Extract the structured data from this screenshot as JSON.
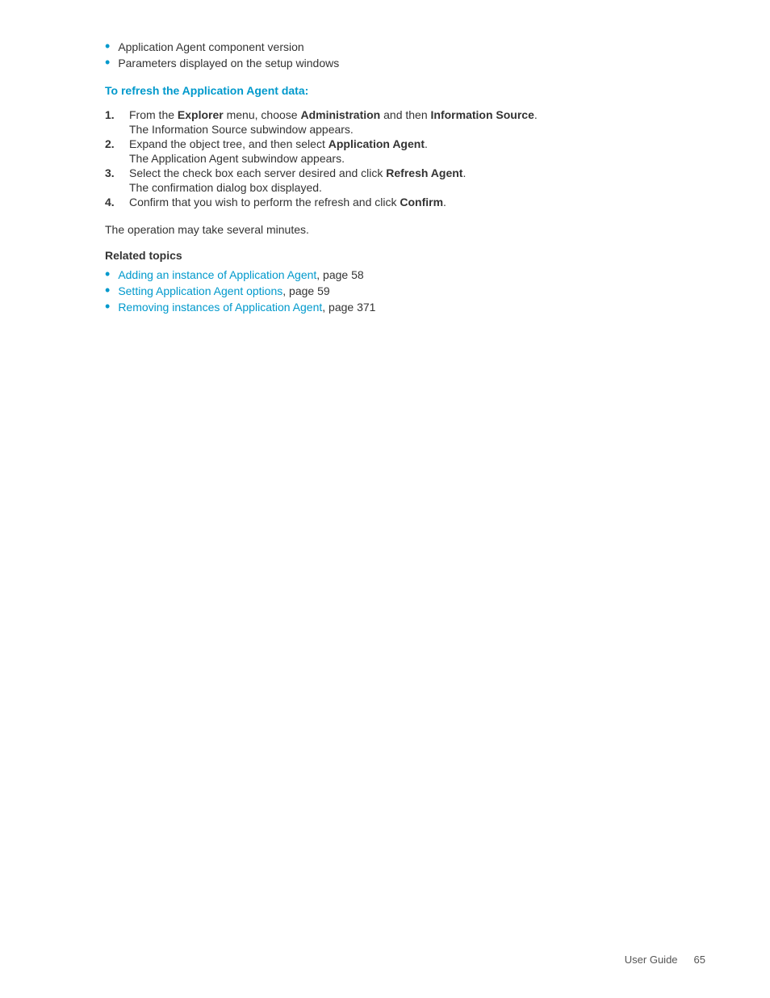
{
  "bullets": [
    "Application Agent component version",
    "Parameters displayed on the setup windows"
  ],
  "section_heading": "To refresh the Application Agent data:",
  "steps": [
    {
      "number": "1.",
      "text_parts": [
        {
          "text": "From the ",
          "bold": false
        },
        {
          "text": "Explorer",
          "bold": true
        },
        {
          "text": " menu, choose ",
          "bold": false
        },
        {
          "text": "Administration",
          "bold": true
        },
        {
          "text": " and then ",
          "bold": false
        },
        {
          "text": "Information Source",
          "bold": true
        },
        {
          "text": ".",
          "bold": false
        }
      ],
      "subtext": "The Information Source subwindow appears."
    },
    {
      "number": "2.",
      "text_parts": [
        {
          "text": "Expand the object tree, and then select ",
          "bold": false
        },
        {
          "text": "Application Agent",
          "bold": true
        },
        {
          "text": ".",
          "bold": false
        }
      ],
      "subtext": "The Application Agent subwindow appears."
    },
    {
      "number": "3.",
      "text_parts": [
        {
          "text": "Select the check box each server desired and click ",
          "bold": false
        },
        {
          "text": "Refresh Agent",
          "bold": true
        },
        {
          "text": ".",
          "bold": false
        }
      ],
      "subtext": "The confirmation dialog box displayed."
    },
    {
      "number": "4.",
      "text_parts": [
        {
          "text": "Confirm that you wish to perform the refresh and click ",
          "bold": false
        },
        {
          "text": "Confirm",
          "bold": true
        },
        {
          "text": ".",
          "bold": false
        }
      ],
      "subtext": ""
    }
  ],
  "operation_note": "The operation may take several minutes.",
  "related_topics_heading": "Related topics",
  "related_links": [
    {
      "link_text": "Adding an instance of Application Agent",
      "suffix": ", page 58"
    },
    {
      "link_text": "Setting Application Agent options",
      "suffix": ", page 59"
    },
    {
      "link_text": "Removing instances of Application Agent",
      "suffix": ", page 371"
    }
  ],
  "footer": {
    "label": "User Guide",
    "page": "65"
  }
}
